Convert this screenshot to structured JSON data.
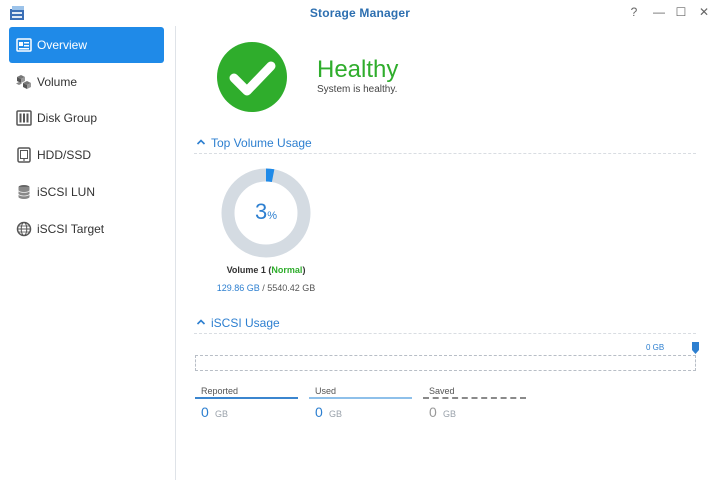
{
  "window": {
    "title": "Storage Manager",
    "help_symbol": "?",
    "min_symbol": "—",
    "max_symbol": "☐",
    "close_symbol": "✕"
  },
  "sidebar": {
    "items": [
      {
        "label": "Overview",
        "icon": "overview-icon",
        "active": true
      },
      {
        "label": "Volume",
        "icon": "volume-icon",
        "active": false
      },
      {
        "label": "Disk Group",
        "icon": "disk-group-icon",
        "active": false
      },
      {
        "label": "HDD/SSD",
        "icon": "hdd-icon",
        "active": false
      },
      {
        "label": "iSCSI LUN",
        "icon": "lun-icon",
        "active": false
      },
      {
        "label": "iSCSI Target",
        "icon": "globe-icon",
        "active": false
      }
    ]
  },
  "status": {
    "title": "Healthy",
    "subtitle": "System is healthy.",
    "color": "#2fad2c"
  },
  "top_volume": {
    "section_label": "Top Volume Usage",
    "percent_value": "3",
    "percent_fraction": 0.03,
    "percent_symbol": "%",
    "volume_name": "Volume 1",
    "volume_status": "Normal",
    "open_paren": " (",
    "close_paren": ")",
    "used": "129.86 GB",
    "separator": " / ",
    "total": "5540.42 GB"
  },
  "iscsi": {
    "section_label": "iSCSI Usage",
    "max_label": "0 GB",
    "stats": [
      {
        "label": "Reported",
        "value": "0",
        "unit": "GB"
      },
      {
        "label": "Used",
        "value": "0",
        "unit": "GB"
      },
      {
        "label": "Saved",
        "value": "0",
        "unit": "GB"
      }
    ]
  },
  "colors": {
    "accent": "#1f8ae8",
    "link": "#2d7fd0",
    "healthy": "#2fad2c",
    "donut_track": "#d4dbe2"
  }
}
